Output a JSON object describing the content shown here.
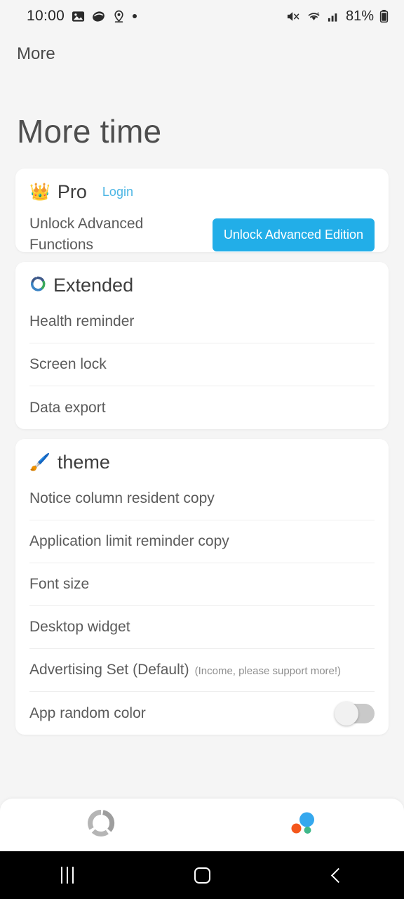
{
  "statusbar": {
    "time": "10:00",
    "battery_percent": "81%",
    "icons_left": [
      "image-icon",
      "dark-oval-icon",
      "location-pin-icon",
      "dot-icon"
    ],
    "icons_right": [
      "mute-icon",
      "wifi6-icon",
      "signal-bars-icon",
      "battery-icon"
    ]
  },
  "app": {
    "tab_title": "More",
    "page_title": "More time"
  },
  "pro_card": {
    "icon": "crown-emoji",
    "title": "Pro",
    "login_label": "Login",
    "description": "Unlock Advanced Functions",
    "cta_label": "Unlock Advanced Edition",
    "cta_color": "#22aee8",
    "link_color": "#4db6e4"
  },
  "extended_card": {
    "icon": "recycle-ring-icon",
    "title": "Extended",
    "rows": [
      {
        "label": "Health reminder"
      },
      {
        "label": "Screen lock"
      },
      {
        "label": "Data export"
      }
    ]
  },
  "theme_card": {
    "icon": "paintbrush-emoji",
    "title": "theme",
    "rows": [
      {
        "label": "Notice column resident copy"
      },
      {
        "label": "Application limit reminder copy"
      },
      {
        "label": "Font size"
      },
      {
        "label": "Desktop widget"
      },
      {
        "label": "Advertising Set (Default)",
        "sub": "(Income, please support more!)"
      },
      {
        "label": "App random color",
        "toggle": "off"
      }
    ]
  },
  "bottom_nav": {
    "items": [
      {
        "icon": "segmented-ring-icon",
        "state": "inactive"
      },
      {
        "icon": "color-dots-icon",
        "state": "active"
      }
    ]
  },
  "android_nav": {
    "items": [
      "recents-icon",
      "home-icon",
      "back-icon"
    ]
  }
}
